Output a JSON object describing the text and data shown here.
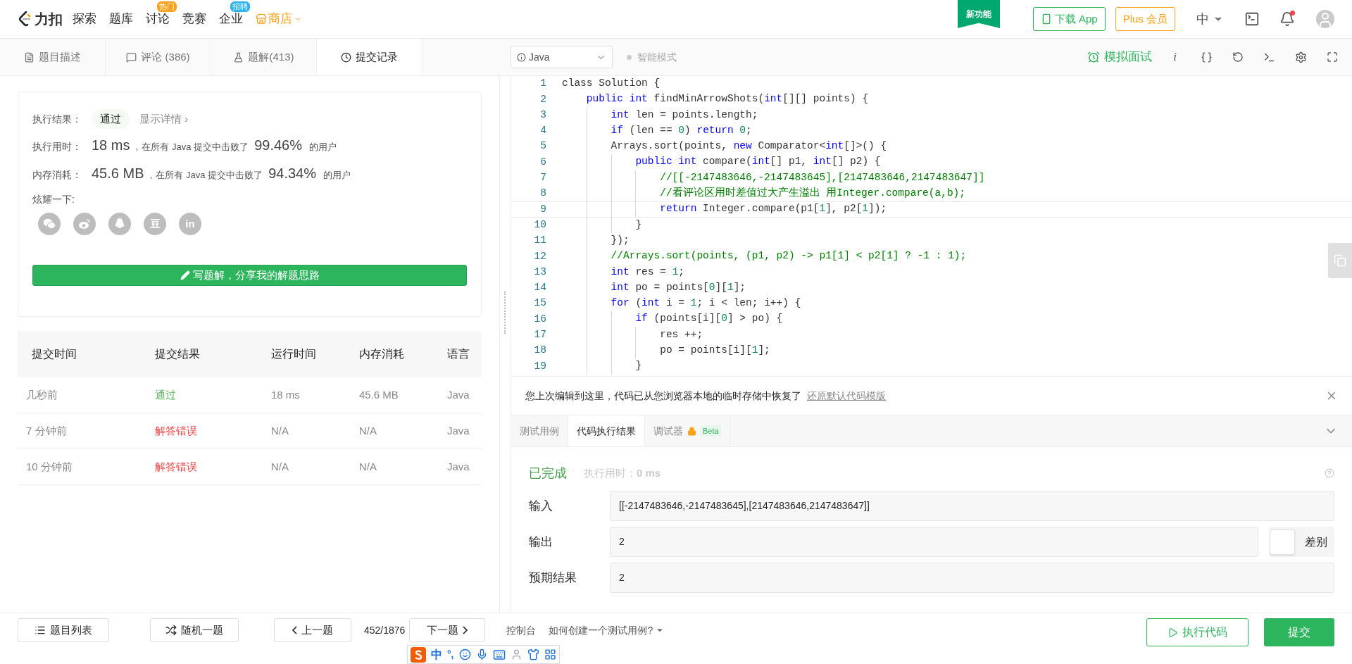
{
  "nav": {
    "logo": "力扣",
    "items": [
      {
        "label": "探索",
        "kind": "plain"
      },
      {
        "label": "题库",
        "kind": "plain"
      },
      {
        "label": "讨论",
        "badge": "热门",
        "color": "#ffa116",
        "kind": "plain"
      },
      {
        "label": "竞赛",
        "kind": "plain"
      },
      {
        "label": "企业",
        "badge": "招聘",
        "color": "#2db3f0",
        "kind": "plain"
      },
      {
        "label": "商店",
        "kind": "store"
      }
    ],
    "new_feature": "新功能",
    "download": "下载 App",
    "plus": "Plus 会员",
    "lang": "中",
    "has_notification": true
  },
  "left_tabs": [
    {
      "label": "题目描述",
      "kind": "description",
      "selected": false
    },
    {
      "label": "评论 (386)",
      "kind": "comments",
      "selected": false
    },
    {
      "label": "题解(413)",
      "kind": "solutions",
      "selected": false
    },
    {
      "label": "提交记录",
      "kind": "submissions",
      "selected": true
    }
  ],
  "editor_toolbar": {
    "language": "Java",
    "smart_mode": {
      "label": "智能模式",
      "on": false
    },
    "interview": "模拟面试",
    "icon_text": "i"
  },
  "result_card": {
    "result_label": "执行结果：",
    "result": "通过",
    "details": "显示详情 ›",
    "rows": [
      {
        "label": "执行用时：",
        "value": "18 ms",
        "text": "，在所有 Java 提交中击败了",
        "percent": "99.46%",
        "suffix": "的用户"
      },
      {
        "label": "内存消耗：",
        "value": "45.6 MB",
        "text": "，在所有 Java 提交中击败了",
        "percent": "94.34%",
        "suffix": "的用户"
      }
    ],
    "share_label": "炫耀一下:",
    "share": [
      {
        "kind": "wechat"
      },
      {
        "kind": "weibo"
      },
      {
        "kind": "qq"
      },
      {
        "kind": "text",
        "label": "豆"
      },
      {
        "kind": "text",
        "label": "in"
      }
    ],
    "write_button": "写题解，分享我的解题思路"
  },
  "submissions": {
    "columns": [
      "提交时间",
      "提交结果",
      "运行时间",
      "内存消耗",
      "语言"
    ],
    "rows": [
      {
        "time": "几秒前",
        "result": "通过",
        "kind": "accepted",
        "runtime": "18 ms",
        "memory": "45.6 MB",
        "language": "Java"
      },
      {
        "time": "7 分钟前",
        "result": "解答错误",
        "kind": "wrong",
        "runtime": "N/A",
        "memory": "N/A",
        "language": "Java"
      },
      {
        "time": "10 分钟前",
        "result": "解答错误",
        "kind": "wrong",
        "runtime": "N/A",
        "memory": "N/A",
        "language": "Java"
      }
    ]
  },
  "code": [
    {
      "number": "1",
      "current": false,
      "tokens": [
        {
          "kind": "plain",
          "text": "class Solution {"
        }
      ]
    },
    {
      "number": "2",
      "current": false,
      "tokens": [
        {
          "kind": "keyword",
          "text": "    public"
        },
        {
          "kind": "keyword",
          "text": " int"
        },
        {
          "kind": "plain",
          "text": " findMinArrowShots("
        },
        {
          "kind": "keyword",
          "text": "int"
        },
        {
          "kind": "plain",
          "text": "[][] points) {"
        }
      ]
    },
    {
      "number": "3",
      "current": false,
      "tokens": [
        {
          "kind": "keyword",
          "text": "        int"
        },
        {
          "kind": "plain",
          "text": " len = points.length;"
        }
      ]
    },
    {
      "number": "4",
      "current": false,
      "tokens": [
        {
          "kind": "keyword",
          "text": "        if"
        },
        {
          "kind": "plain",
          "text": " (len == "
        },
        {
          "kind": "number",
          "text": "0"
        },
        {
          "kind": "plain",
          "text": ") "
        },
        {
          "kind": "keyword",
          "text": "return"
        },
        {
          "kind": "number",
          "text": " 0"
        },
        {
          "kind": "plain",
          "text": ";"
        }
      ]
    },
    {
      "number": "5",
      "current": false,
      "tokens": [
        {
          "kind": "plain",
          "text": "        Arrays.sort(points, "
        },
        {
          "kind": "keyword",
          "text": "new"
        },
        {
          "kind": "plain",
          "text": " Comparator<"
        },
        {
          "kind": "keyword",
          "text": "int"
        },
        {
          "kind": "plain",
          "text": "[]>() {"
        }
      ]
    },
    {
      "number": "6",
      "current": false,
      "tokens": [
        {
          "kind": "keyword",
          "text": "            public"
        },
        {
          "kind": "keyword",
          "text": " int"
        },
        {
          "kind": "plain",
          "text": " compare("
        },
        {
          "kind": "keyword",
          "text": "int"
        },
        {
          "kind": "plain",
          "text": "[] p1, "
        },
        {
          "kind": "keyword",
          "text": "int"
        },
        {
          "kind": "plain",
          "text": "[] p2) {"
        }
      ]
    },
    {
      "number": "7",
      "current": false,
      "tokens": [
        {
          "kind": "comment",
          "text": "                //[[-2147483646,-2147483645],[2147483646,2147483647]]"
        }
      ]
    },
    {
      "number": "8",
      "current": false,
      "tokens": [
        {
          "kind": "comment",
          "text": "                //看评论区用时差值过大产生溢出 用Integer.compare(a,b);"
        }
      ]
    },
    {
      "number": "9",
      "current": true,
      "tokens": [
        {
          "kind": "keyword",
          "text": "                return"
        },
        {
          "kind": "plain",
          "text": " Integer.compare(p1["
        },
        {
          "kind": "number",
          "text": "1"
        },
        {
          "kind": "plain",
          "text": "], p2["
        },
        {
          "kind": "number",
          "text": "1"
        },
        {
          "kind": "plain",
          "text": "]);"
        }
      ]
    },
    {
      "number": "10",
      "current": false,
      "tokens": [
        {
          "kind": "plain",
          "text": "            }"
        }
      ]
    },
    {
      "number": "11",
      "current": false,
      "tokens": [
        {
          "kind": "plain",
          "text": "        });"
        }
      ]
    },
    {
      "number": "12",
      "current": false,
      "tokens": [
        {
          "kind": "comment",
          "text": "        //Arrays.sort(points, (p1, p2) -> p1[1] < p2[1] ? -1 : 1);"
        }
      ]
    },
    {
      "number": "13",
      "current": false,
      "tokens": [
        {
          "kind": "keyword",
          "text": "        int"
        },
        {
          "kind": "plain",
          "text": " res = "
        },
        {
          "kind": "number",
          "text": "1"
        },
        {
          "kind": "plain",
          "text": ";"
        }
      ]
    },
    {
      "number": "14",
      "current": false,
      "tokens": [
        {
          "kind": "keyword",
          "text": "        int"
        },
        {
          "kind": "plain",
          "text": " po = points["
        },
        {
          "kind": "number",
          "text": "0"
        },
        {
          "kind": "plain",
          "text": "]["
        },
        {
          "kind": "number",
          "text": "1"
        },
        {
          "kind": "plain",
          "text": "];"
        }
      ]
    },
    {
      "number": "15",
      "current": false,
      "tokens": [
        {
          "kind": "keyword",
          "text": "        for"
        },
        {
          "kind": "plain",
          "text": " ("
        },
        {
          "kind": "keyword",
          "text": "int"
        },
        {
          "kind": "plain",
          "text": " i = "
        },
        {
          "kind": "number",
          "text": "1"
        },
        {
          "kind": "plain",
          "text": "; i < len; i++) {"
        }
      ]
    },
    {
      "number": "16",
      "current": false,
      "tokens": [
        {
          "kind": "keyword",
          "text": "            if"
        },
        {
          "kind": "plain",
          "text": " (points[i]["
        },
        {
          "kind": "number",
          "text": "0"
        },
        {
          "kind": "plain",
          "text": "] > po) {"
        }
      ]
    },
    {
      "number": "17",
      "current": false,
      "tokens": [
        {
          "kind": "plain",
          "text": "                res ++;"
        }
      ]
    },
    {
      "number": "18",
      "current": false,
      "tokens": [
        {
          "kind": "plain",
          "text": "                po = points[i]["
        },
        {
          "kind": "number",
          "text": "1"
        },
        {
          "kind": "plain",
          "text": "];"
        }
      ]
    },
    {
      "number": "19",
      "current": false,
      "tokens": [
        {
          "kind": "plain",
          "text": "            }"
        }
      ]
    }
  ],
  "notice": {
    "text": "您上次编辑到这里，代码已从您浏览器本地的临时存储中恢复了",
    "link": "还原默认代码模版"
  },
  "console_tabs": [
    {
      "label": "测试用例",
      "selected": false
    },
    {
      "label": "代码执行结果",
      "selected": true
    },
    {
      "label": "调试器",
      "selected": false,
      "badge": "Beta"
    }
  ],
  "run_result": {
    "status": "已完成",
    "time": "执行用时：**0 ms**",
    "fields": [
      {
        "label": "输入",
        "value": "[[-2147483646,-2147483645],[2147483646,2147483647]]"
      },
      {
        "label": "输出",
        "value": "2",
        "diff": {
          "label": "差别",
          "checked": false
        }
      },
      {
        "label": "预期结果",
        "value": "2"
      }
    ]
  },
  "bottom": {
    "problem_list": "题目列表",
    "random": "随机一题",
    "prev": "上一题",
    "progress": "452/1876",
    "next": "下一题",
    "console": "控制台",
    "help": "如何创建一个测试用例?",
    "run": "执行代码",
    "submit": "提交"
  },
  "ime": {
    "mode": "中",
    "punct": "°,"
  }
}
